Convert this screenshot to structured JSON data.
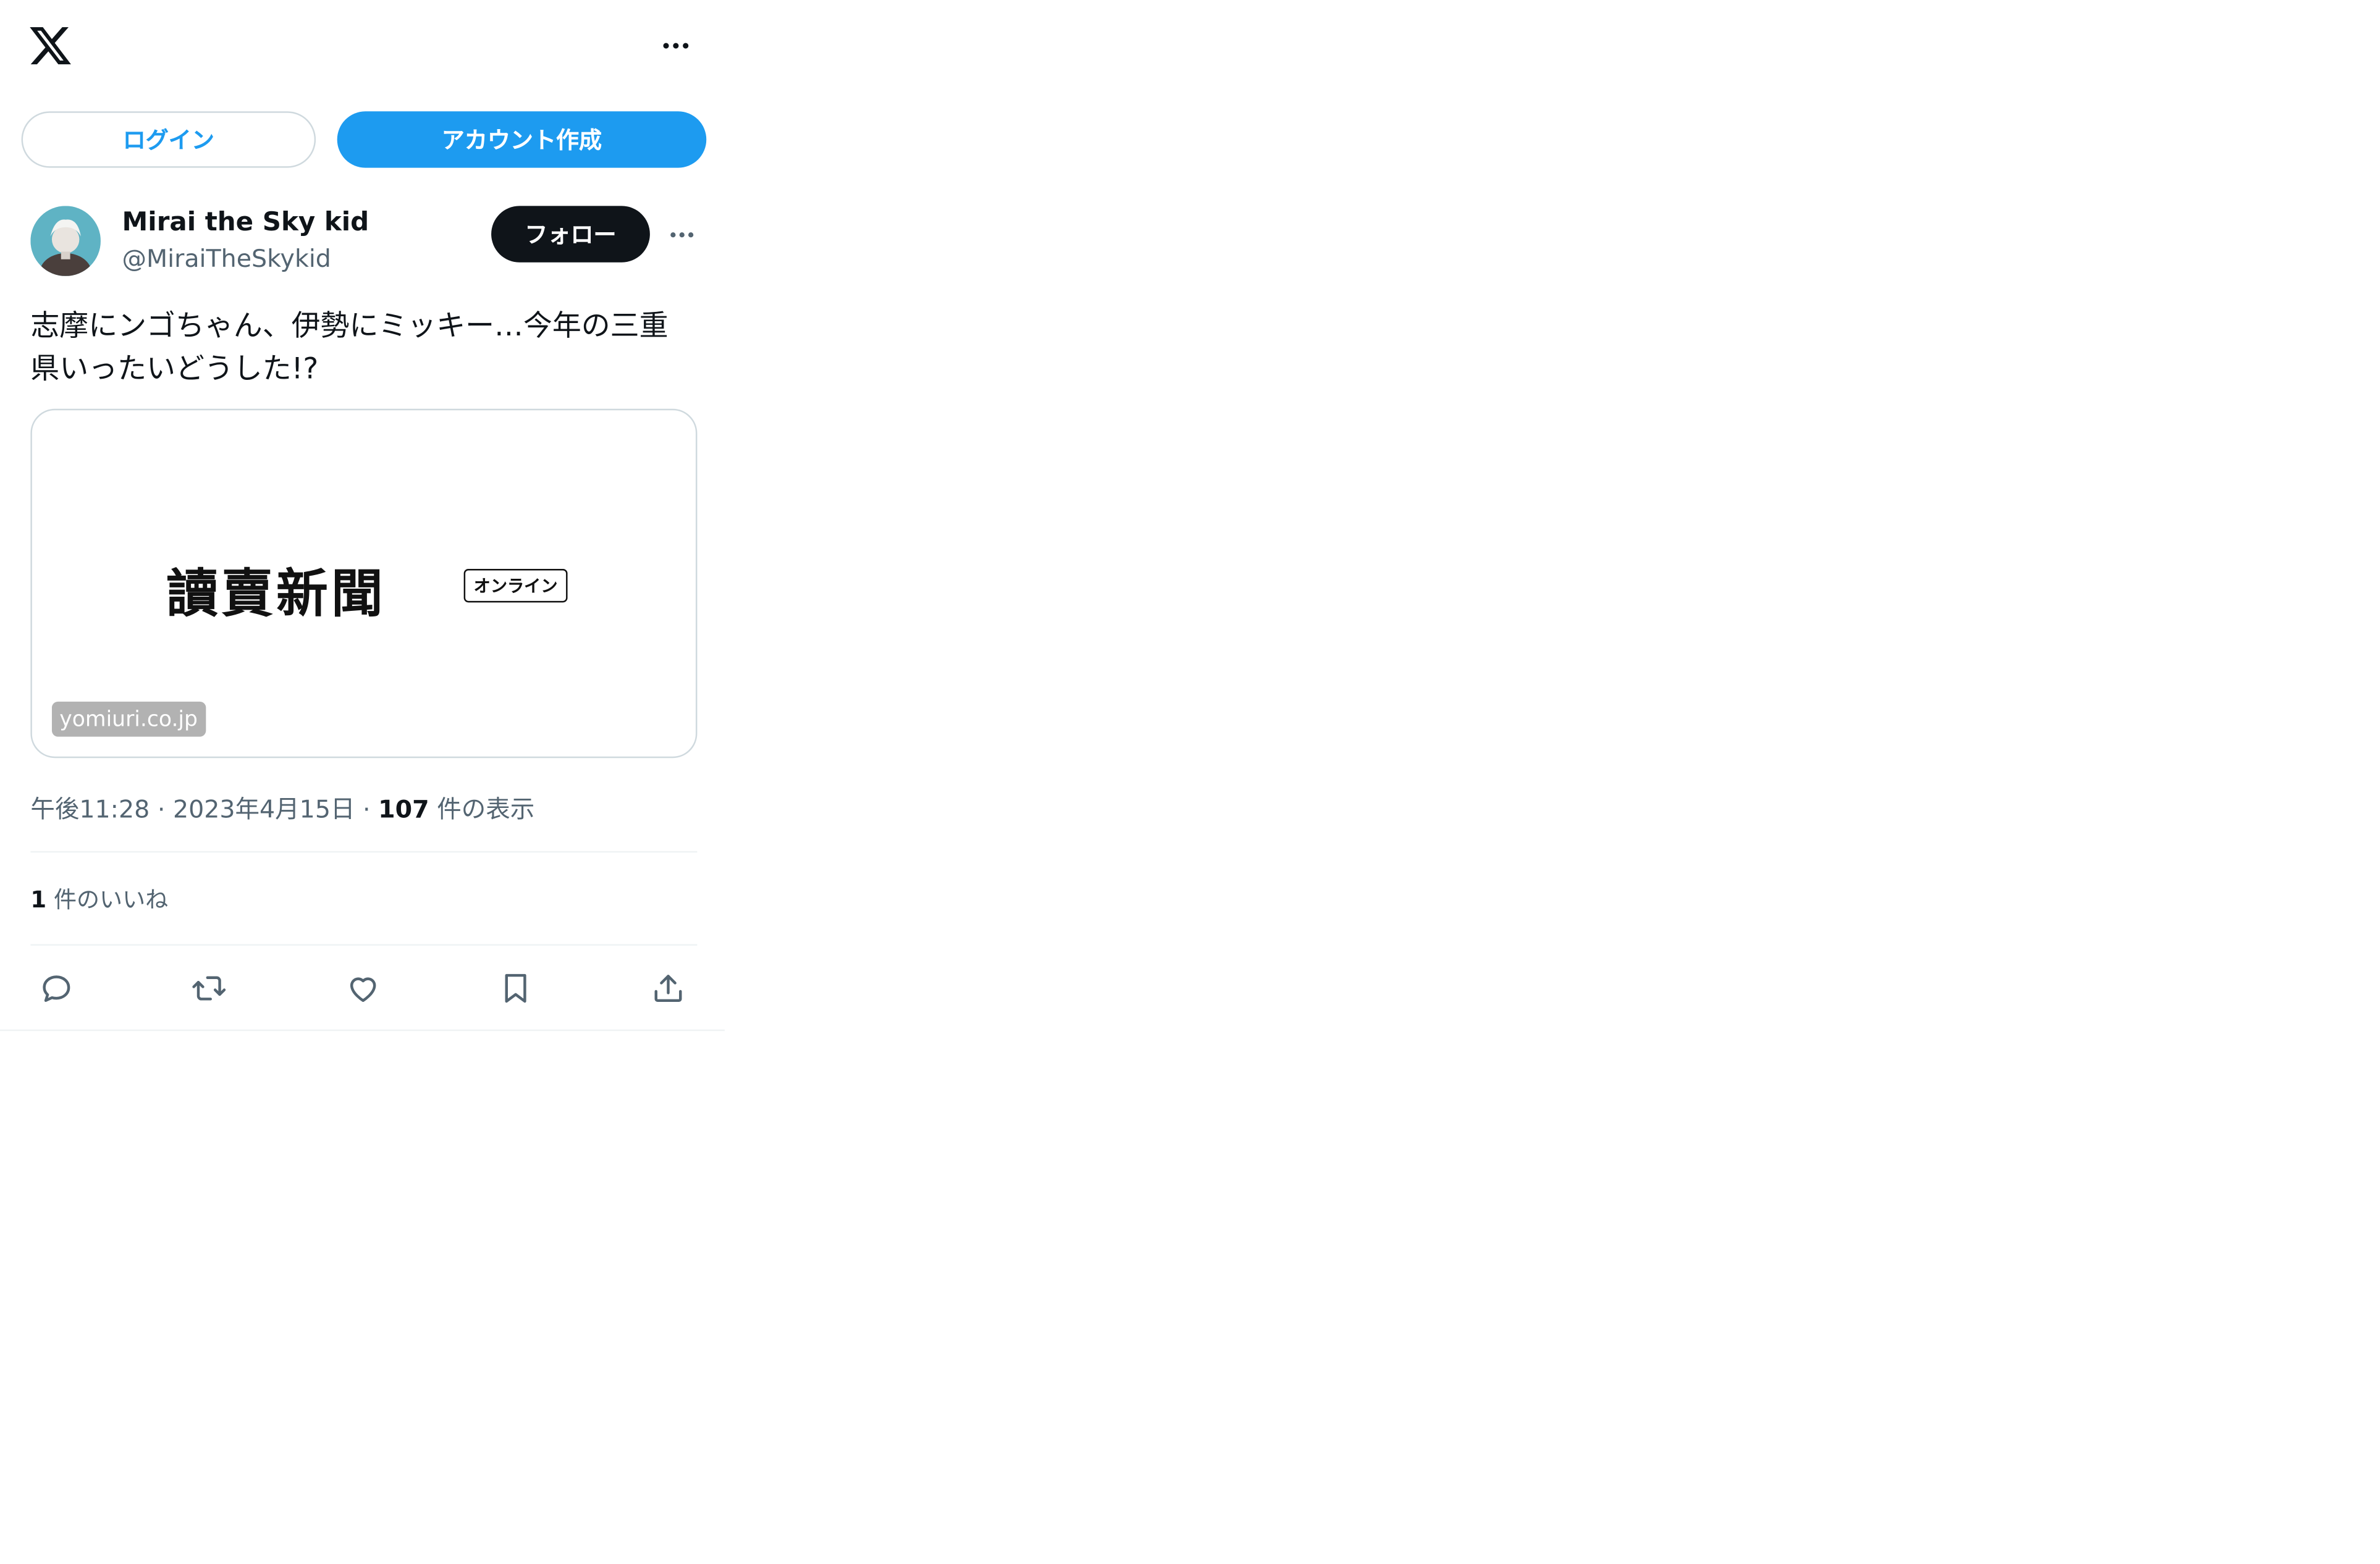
{
  "header": {
    "logo_icon": "x-logo-icon",
    "more_icon": "more-horizontal-icon"
  },
  "auth": {
    "login_label": "ログイン",
    "signup_label": "アカウント作成"
  },
  "post": {
    "author": {
      "display_name": "Mirai the Sky kid",
      "handle": "@MiraiTheSkykid",
      "avatar_icon": "avatar"
    },
    "follow_label": "フォロー",
    "text": "志摩にンゴちゃん、伊勢にミッキー…今年の三重\n県いったいどうした!?",
    "card": {
      "masthead": "讀賣新聞",
      "badge": "オンライン",
      "domain": "yomiuri.co.jp"
    },
    "meta": {
      "time": "午後11:28",
      "date": "2023年4月15日",
      "views_count": "107",
      "views_label": "件の表示"
    },
    "likes": {
      "count": "1",
      "label": "件のいいね"
    },
    "actions": [
      "reply-icon",
      "repost-icon",
      "like-icon",
      "bookmark-icon",
      "share-icon"
    ]
  },
  "colors": {
    "accent": "#1d9bf0",
    "text_primary": "#0f1419",
    "text_secondary": "#536471",
    "border": "#cfd9de"
  }
}
